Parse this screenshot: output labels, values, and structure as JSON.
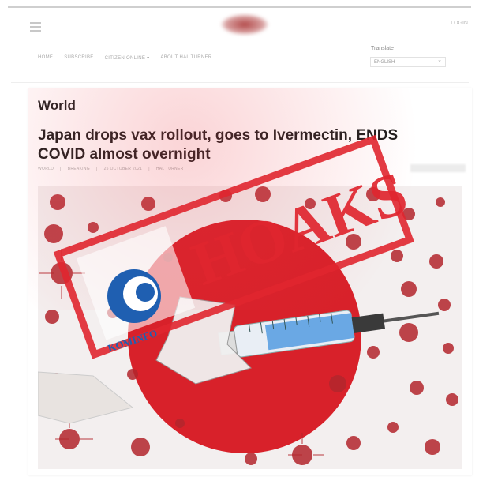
{
  "header": {
    "login_label": "LOGIN"
  },
  "nav": {
    "items": [
      "HOME",
      "SUBSCRIBE",
      "CITIZEN ONLINE ▾",
      "ABOUT HAL TURNER"
    ]
  },
  "translate": {
    "label": "Translate",
    "selected": "ENGLISH"
  },
  "article": {
    "section": "World",
    "title": "Japan drops vax rollout, goes to Ivermectin, ENDS COVID almost overnight",
    "meta": [
      "WORLD",
      "BREAKING",
      "25 OCTOBER 2021",
      "HAL TURNER"
    ]
  },
  "stamp": {
    "text": "HOAKS",
    "logo_text": "KOMINFO",
    "color": "#e0262f"
  },
  "colors": {
    "flag_red": "#d8212a",
    "virus_red": "#b3262d",
    "syringe_blue": "#6aa8e4"
  }
}
